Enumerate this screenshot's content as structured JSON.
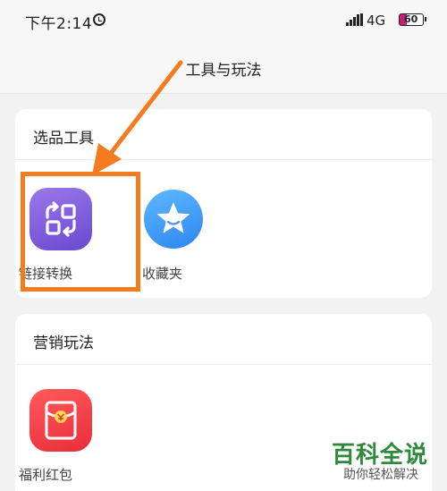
{
  "status_bar": {
    "time": "下午2:14",
    "network": "4G",
    "battery": "60"
  },
  "header": {
    "title": "工具与玩法"
  },
  "sections": [
    {
      "title": "选品工具",
      "items": [
        {
          "label": "链接转换",
          "icon": "link-convert-icon",
          "color": "#7b5be0"
        },
        {
          "label": "收藏夹",
          "icon": "star-icon",
          "color": "#3c97f5"
        }
      ]
    },
    {
      "title": "营销玩法",
      "items": [
        {
          "label": "福利红包",
          "icon": "red-packet-icon",
          "color": "#f0323f"
        }
      ]
    }
  ],
  "annotation": {
    "color": "#f47b20"
  },
  "watermark": {
    "title": "百科全说",
    "subtitle": "助你轻松解决"
  }
}
